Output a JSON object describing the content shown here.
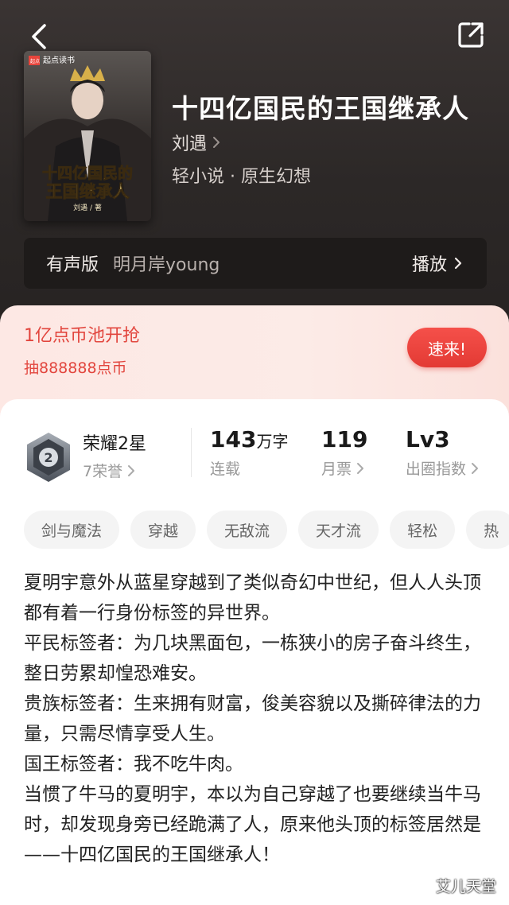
{
  "header": {
    "title": "十四亿国民的王国继承人",
    "author": "刘遇",
    "genre": "轻小说 · 原生幻想",
    "cover": {
      "logo_text": "起点读书",
      "logo_mark": "起点",
      "title_line1": "十四亿国民的",
      "title_line2": "王国继承人",
      "credit": "刘遇 / 著"
    }
  },
  "audio": {
    "label": "有声版",
    "narrator": "明月岸young",
    "play_label": "播放"
  },
  "promo": {
    "title": "1亿点币池开抢",
    "subtitle": "抽888888点币",
    "button_label": "速来!"
  },
  "stats": {
    "rank_name": "荣耀2星",
    "rank_sub": "7荣誉",
    "badge_number": "2",
    "words_value": "143",
    "words_unit": "万字",
    "words_label": "连载",
    "tickets_value": "119",
    "tickets_label": "月票",
    "level_value": "Lv3",
    "level_label": "出圈指数"
  },
  "tags": [
    "剑与魔法",
    "穿越",
    "无敌流",
    "天才流",
    "轻松",
    "热"
  ],
  "description": [
    "夏明宇意外从蓝星穿越到了类似奇幻中世纪，但人人头顶都有着一行身份标签的异世界。",
    "平民标签者：为几块黑面包，一栋狭小的房子奋斗终生，整日劳累却惶恐难安。",
    "贵族标签者：生来拥有财富，俊美容貌以及撕碎律法的力量，只需尽情享受人生。",
    "国王标签者：我不吃牛肉。",
    "当惯了牛马的夏明宇，本以为自己穿越了也要继续当牛马时，却发现身旁已经跪满了人，原来他头顶的标签居然是——十四亿国民的王国继承人！"
  ],
  "watermark": "艾儿天堂",
  "colors": {
    "hero_bg": "#2c2827",
    "accent_red": "#e2463e",
    "promo_bg": "#fde8e4"
  }
}
